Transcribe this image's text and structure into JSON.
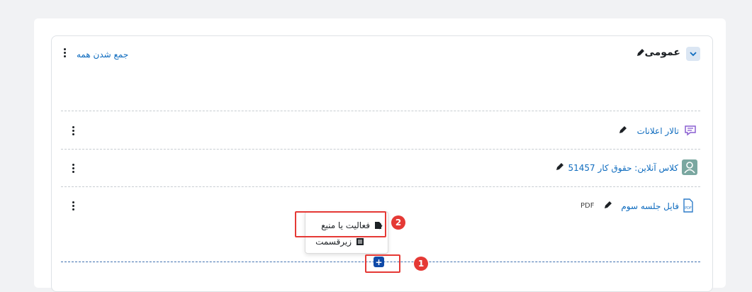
{
  "section": {
    "title": "عمومی",
    "collapse_all": "جمع شدن همه"
  },
  "activities": [
    {
      "name": "تالار اعلانات",
      "icon": "forum-icon",
      "badge": ""
    },
    {
      "name": "کلاس آنلاین: حقوق کار 51457",
      "icon": "online-class-icon",
      "badge": ""
    },
    {
      "name": "فایل جلسه سوم",
      "icon": "pdf-file-icon",
      "badge": "PDF"
    }
  ],
  "add_menu": {
    "items": [
      {
        "label": "فعالیت یا منبع",
        "icon": "add-activity-icon"
      },
      {
        "label": "زیرقسمت",
        "icon": "subsection-icon"
      }
    ],
    "add_button": "+"
  },
  "annotations": {
    "step1": "1",
    "step2": "2"
  },
  "colors": {
    "link": "#0f6cbf",
    "highlight": "#e53935",
    "add_button": "#0f4aa8"
  }
}
